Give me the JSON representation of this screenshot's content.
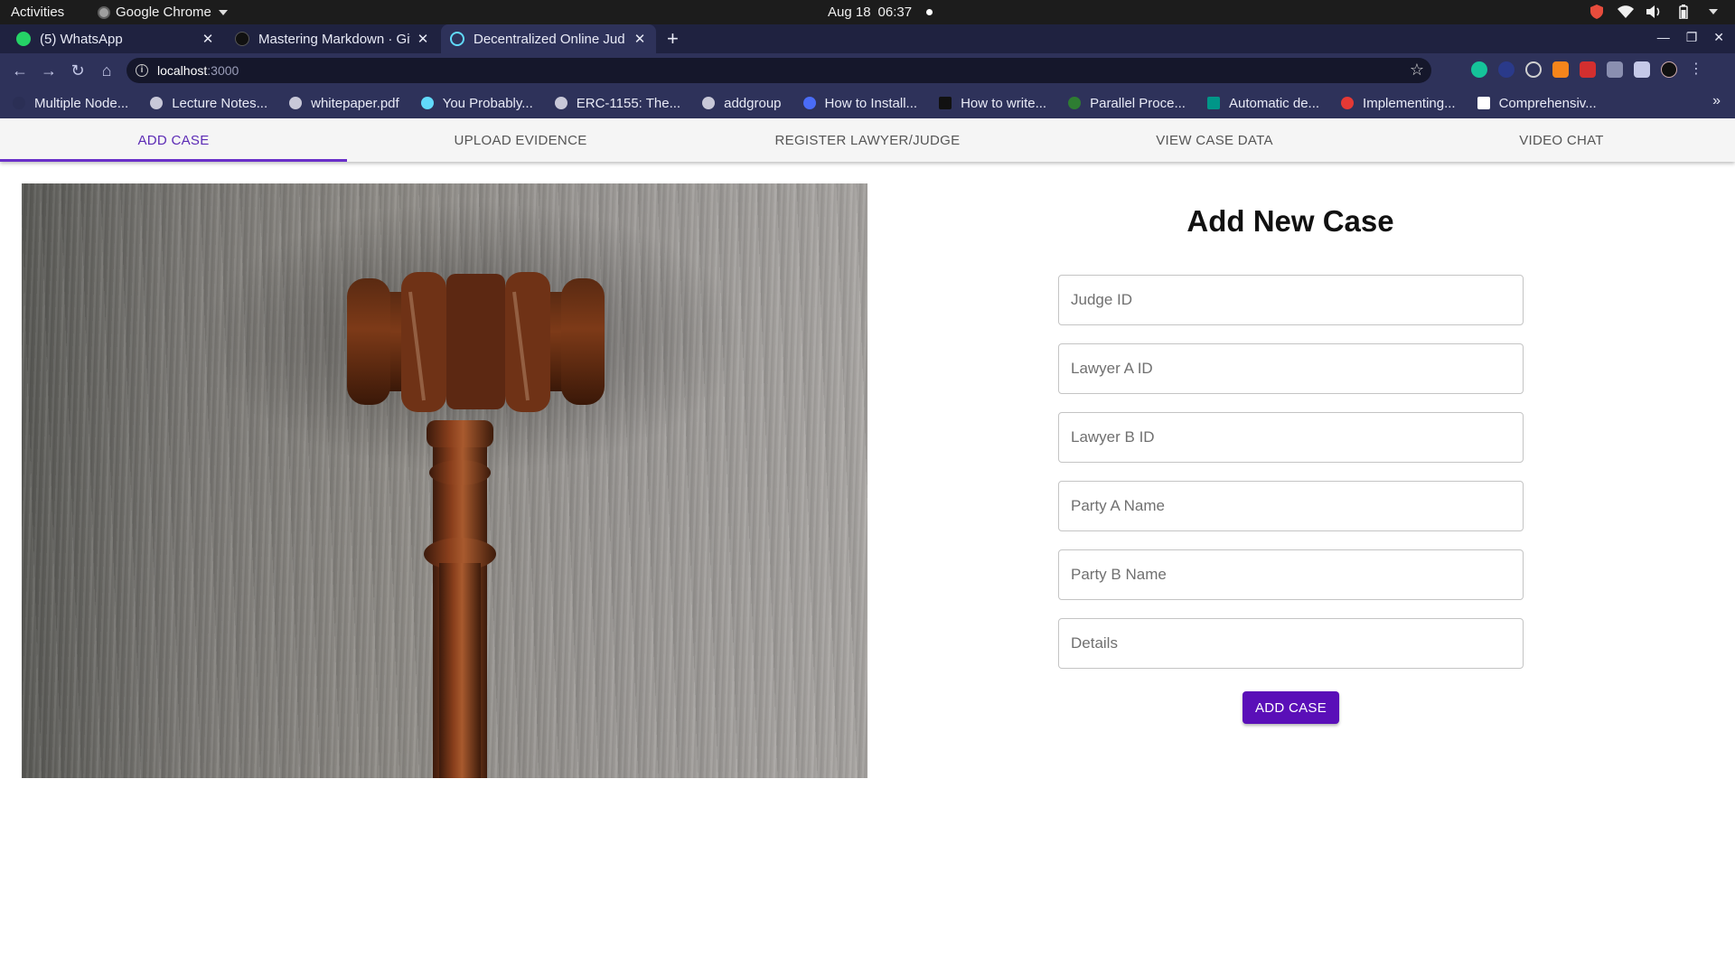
{
  "system_bar": {
    "activities": "Activities",
    "app_name": "Google Chrome",
    "date": "Aug 18",
    "time": "06:37"
  },
  "browser": {
    "tabs": [
      {
        "title": "(5) WhatsApp",
        "favicon_color": "#25d366",
        "active": false
      },
      {
        "title": "Mastering Markdown · Git",
        "favicon_color": "#111111",
        "active": false
      },
      {
        "title": "Decentralized Online Jud",
        "favicon_color": "#61dafb",
        "active": true
      }
    ],
    "new_tab": "+",
    "url_host": "localhost",
    "url_port": ":3000"
  },
  "bookmarks": [
    {
      "label": "Multiple Node...",
      "icon_color": "#2b2f55"
    },
    {
      "label": "Lecture Notes...",
      "icon_color": "#c8c8d8"
    },
    {
      "label": "whitepaper.pdf",
      "icon_color": "#c8c8d8"
    },
    {
      "label": "You Probably...",
      "icon_color": "#61dafb"
    },
    {
      "label": "ERC-1155: The...",
      "icon_color": "#c8c8d8"
    },
    {
      "label": "addgroup",
      "icon_color": "#c8c8d8"
    },
    {
      "label": "How to Install...",
      "icon_color": "#4a6cf7"
    },
    {
      "label": "How to write...",
      "icon_color": "#111111"
    },
    {
      "label": "Parallel Proce...",
      "icon_color": "#2e7d32"
    },
    {
      "label": "Automatic de...",
      "icon_color": "#009688"
    },
    {
      "label": "Implementing...",
      "icon_color": "#e53935"
    },
    {
      "label": "Comprehensiv...",
      "icon_color": "#ffffff"
    }
  ],
  "nav_tabs": [
    {
      "label": "ADD CASE",
      "active": true
    },
    {
      "label": "UPLOAD EVIDENCE",
      "active": false
    },
    {
      "label": "REGISTER LAWYER/JUDGE",
      "active": false
    },
    {
      "label": "VIEW CASE DATA",
      "active": false
    },
    {
      "label": "VIDEO CHAT",
      "active": false
    }
  ],
  "form": {
    "title": "Add New Case",
    "fields": [
      {
        "placeholder": "Judge ID",
        "value": ""
      },
      {
        "placeholder": "Lawyer A ID",
        "value": ""
      },
      {
        "placeholder": "Lawyer B ID",
        "value": ""
      },
      {
        "placeholder": "Party A Name",
        "value": ""
      },
      {
        "placeholder": "Party B Name",
        "value": ""
      },
      {
        "placeholder": "Details",
        "value": ""
      }
    ],
    "submit_label": "ADD CASE"
  },
  "colors": {
    "accent": "#5a0fb8",
    "tab_indicator": "#6a2fc9",
    "browser_frame": "#2e325a"
  }
}
